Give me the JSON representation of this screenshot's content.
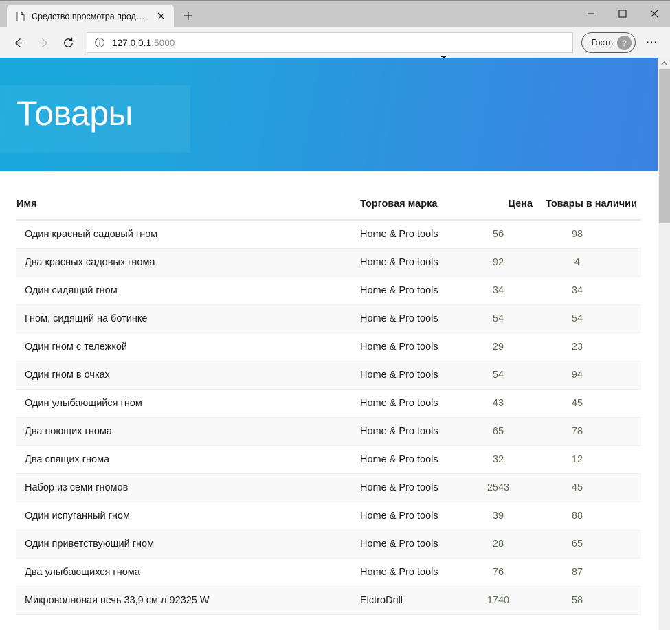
{
  "browser": {
    "tab": {
      "title": "Средство просмотра продуктов",
      "favicon": "page-icon",
      "close_label": "✕"
    },
    "new_tab_label": "+",
    "window_controls": {
      "minimize": "—",
      "maximize": "☐",
      "close": "✕"
    },
    "nav": {
      "back": "←",
      "forward": "→",
      "reload": "⟳"
    },
    "address_bar": {
      "host": "127.0.0.1",
      "port": ":5000",
      "info_icon": "info-icon"
    },
    "profile": {
      "label": "Гость",
      "avatar_icon": "guest-avatar-icon"
    },
    "more_label": "⋯"
  },
  "page": {
    "hero_title": "Товары",
    "table": {
      "columns": [
        {
          "key": "name",
          "label": "Имя"
        },
        {
          "key": "brand",
          "label": "Торговая марка"
        },
        {
          "key": "price",
          "label": "Цена"
        },
        {
          "key": "stock",
          "label": "Товары в наличии"
        }
      ],
      "rows": [
        {
          "name": "Один красный садовый гном",
          "brand": "Home & Pro tools",
          "price": "56",
          "stock": "98"
        },
        {
          "name": "Два красных садовых гнома",
          "brand": "Home & Pro tools",
          "price": "92",
          "stock": "4"
        },
        {
          "name": "Один сидящий гном",
          "brand": "Home & Pro tools",
          "price": "34",
          "stock": "34"
        },
        {
          "name": "Гном, сидящий на ботинке",
          "brand": "Home & Pro tools",
          "price": "54",
          "stock": "54"
        },
        {
          "name": "Один гном с тележкой",
          "brand": "Home & Pro tools",
          "price": "29",
          "stock": "23"
        },
        {
          "name": "Один гном в очках",
          "brand": "Home & Pro tools",
          "price": "54",
          "stock": "94"
        },
        {
          "name": "Один улыбающийся гном",
          "brand": "Home & Pro tools",
          "price": "43",
          "stock": "45"
        },
        {
          "name": "Два поющих гнома",
          "brand": "Home & Pro tools",
          "price": "65",
          "stock": "78"
        },
        {
          "name": "Два спящих гнома",
          "brand": "Home & Pro tools",
          "price": "32",
          "stock": "12"
        },
        {
          "name": "Набор из семи гномов",
          "brand": "Home & Pro tools",
          "price": "2543",
          "stock": "45"
        },
        {
          "name": "Один испуганный гном",
          "brand": "Home & Pro tools",
          "price": "39",
          "stock": "88"
        },
        {
          "name": "Один приветствующий гном",
          "brand": "Home & Pro tools",
          "price": "28",
          "stock": "65"
        },
        {
          "name": "Два улыбающихся гнома",
          "brand": "Home & Pro tools",
          "price": "76",
          "stock": "87"
        },
        {
          "name": "Микроволновая печь 33,9 см л 92325 W",
          "brand": "ElctroDrill",
          "price": "1740",
          "stock": "58"
        }
      ]
    }
  },
  "colors": {
    "hero_gradient_start": "#18AADD",
    "hero_gradient_end": "#3C82E1",
    "numeric_text": "#5f6a52",
    "row_stripe": "#F9F9F9"
  }
}
